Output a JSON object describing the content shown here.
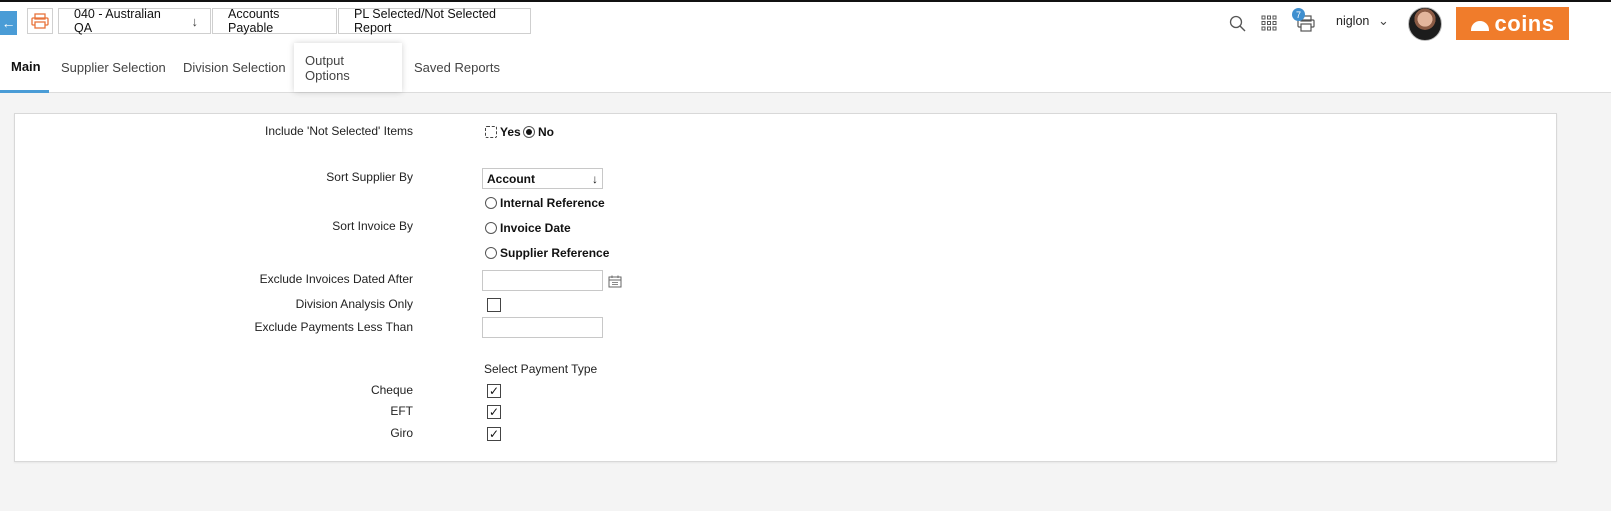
{
  "header": {
    "breadcrumbs": [
      {
        "label": "040 - Australian QA",
        "has_dropdown": true
      },
      {
        "label": "Accounts Payable",
        "has_dropdown": false
      },
      {
        "label": "PL Selected/Not Selected Report",
        "has_dropdown": false
      }
    ],
    "print_count": "7",
    "user": "niglon",
    "logo_text": "coins",
    "icons": [
      "back-arrow-icon",
      "printer-icon",
      "search-icon",
      "apps-grid-icon",
      "print-queue-icon",
      "chevron-down-icon"
    ]
  },
  "tabs": [
    {
      "label": "Main",
      "active": true
    },
    {
      "label": "Supplier Selection",
      "active": false
    },
    {
      "label": "Division Selection",
      "active": false
    },
    {
      "label": "Output Options",
      "active": false
    },
    {
      "label": "Saved Reports",
      "active": false
    }
  ],
  "form": {
    "include_not_selected": {
      "label": "Include 'Not Selected' Items",
      "options": [
        "Yes",
        "No"
      ],
      "selected": "No"
    },
    "sort_supplier": {
      "label": "Sort Supplier By",
      "value": "Account"
    },
    "sort_invoice": {
      "label": "Sort Invoice By",
      "options": [
        "Internal Reference",
        "Invoice Date",
        "Supplier Reference"
      ],
      "selected": null
    },
    "exclude_invoices_after": {
      "label": "Exclude Invoices Dated After",
      "value": ""
    },
    "division_analysis_only": {
      "label": "Division Analysis Only",
      "checked": false
    },
    "exclude_payments_less_than": {
      "label": "Exclude Payments Less Than",
      "value": ""
    },
    "payment_type": {
      "title": "Select Payment Type",
      "items": [
        {
          "label": "Cheque",
          "checked": true
        },
        {
          "label": "EFT",
          "checked": true
        },
        {
          "label": "Giro",
          "checked": true
        }
      ]
    }
  },
  "colors": {
    "accent": "#4a9cd6",
    "brand": "#f07c2b",
    "badge": "#3f8fcf"
  }
}
